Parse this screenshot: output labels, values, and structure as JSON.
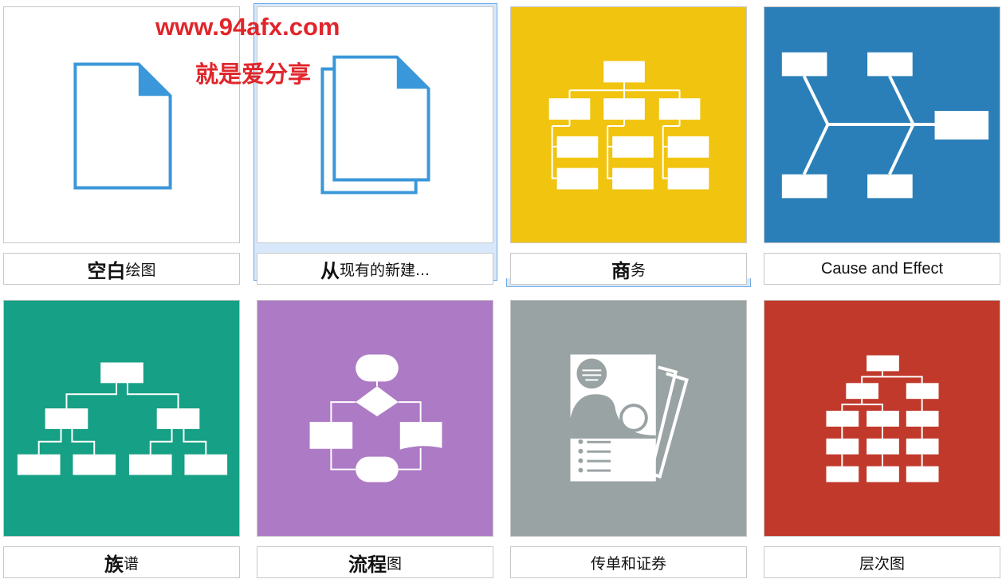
{
  "watermark": {
    "line1": "www.94afx.com",
    "line2": "就是爱分享"
  },
  "templates": [
    {
      "label_main": "空白",
      "label_rest": "绘图",
      "icon": "blank-document-icon",
      "color": "#ffffff"
    },
    {
      "label_main": "从",
      "label_rest": "现有的新建...",
      "icon": "copy-document-icon",
      "color": "#ffffff",
      "selected": true
    },
    {
      "label_main": "商",
      "label_rest": "务",
      "icon": "org-chart-icon",
      "color": "#f1c40f"
    },
    {
      "label_main": "",
      "label_rest": "Cause and Effect",
      "icon": "fishbone-icon",
      "color": "#2b7fb8"
    },
    {
      "label_main": "族",
      "label_rest": "谱",
      "icon": "family-tree-icon",
      "color": "#16a085"
    },
    {
      "label_main": "流程",
      "label_rest": "图",
      "icon": "flowchart-icon",
      "color": "#ad7ac5"
    },
    {
      "label_main": "",
      "label_rest": "传单和证券",
      "icon": "flyer-icon",
      "color": "#9aa3a4"
    },
    {
      "label_main": "",
      "label_rest": "层次图",
      "icon": "hierarchy-icon",
      "color": "#c0392b"
    }
  ]
}
